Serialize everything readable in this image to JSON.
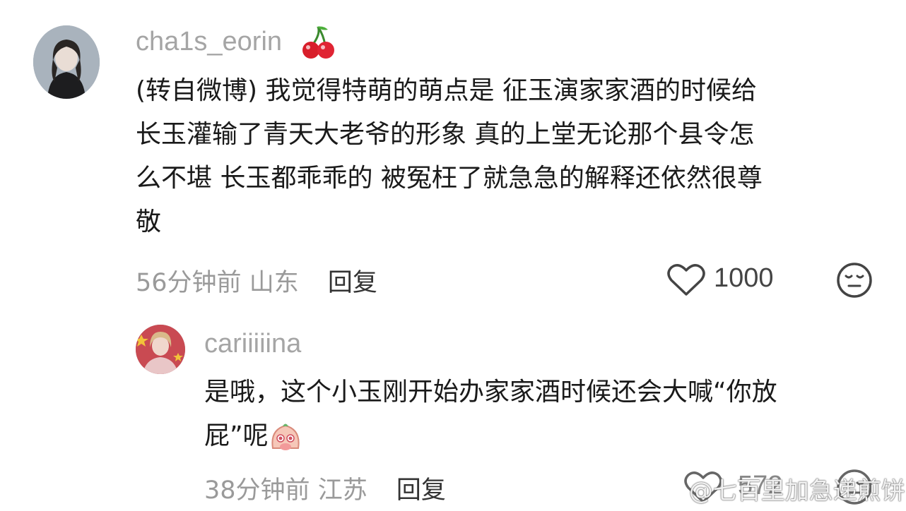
{
  "comment": {
    "username": "cha1s_eorin",
    "lines": [
      "(转自微博) 我觉得特萌的萌点是 征玉演家家酒的时候给",
      "长玉灌输了青天大老爷的形象 真的上堂无论那个县令怎",
      "么不堪 长玉都乖乖的 被冤枉了就急急的解释还依然很尊",
      "敬"
    ],
    "time": "56分钟前",
    "location": "山东",
    "reply_label": "回复",
    "likes": "1000"
  },
  "reply": {
    "username": "cariiiiina",
    "lines": [
      "是哦，这个小玉刚开始办家家酒时候还会大喊“你放",
      "屁”呢"
    ],
    "time": "38分钟前",
    "location": "江苏",
    "reply_label": "回复",
    "likes": "572"
  },
  "watermark": "@七百里加急递煎饼",
  "icons": [
    "cherry-icon",
    "heart-icon",
    "neutral-face-icon",
    "crying-bun-emoji",
    "weibo-logo-icon"
  ]
}
